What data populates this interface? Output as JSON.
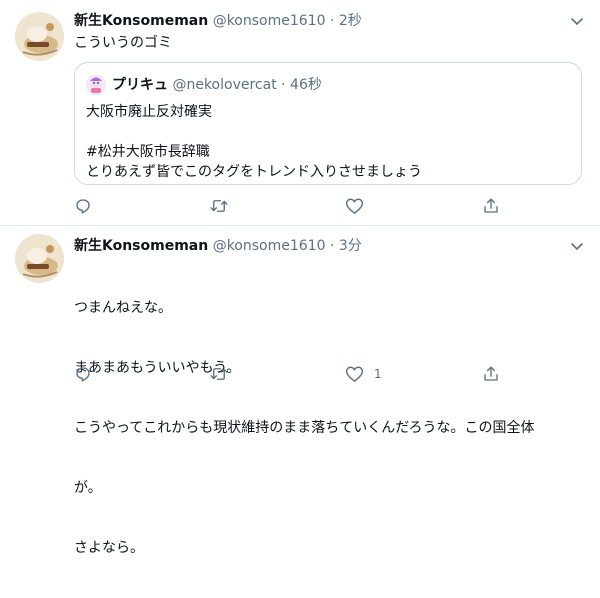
{
  "colors": {
    "muted": "#5b7083",
    "border": "#cfd9de",
    "divider": "#e6ecf0"
  },
  "tweets": [
    {
      "display_name": "新生Konsomeman",
      "handle": "@konsome1610",
      "separator": "·",
      "time": "2秒",
      "text": "こういうのゴミ",
      "quote": {
        "display_name": "プリキュ",
        "handle": "@nekolovercat",
        "separator": "·",
        "time": "46秒",
        "lines": [
          "大阪市廃止反対確実",
          "",
          "#松井大阪市長辞職",
          "とりあえず皆でこのタグをトレンド入りさせましょう"
        ]
      },
      "actions": {
        "reply_icon": "reply-icon",
        "retweet_icon": "retweet-icon",
        "like_icon": "heart-icon",
        "like_count": "",
        "share_icon": "share-icon"
      }
    },
    {
      "display_name": "新生Konsomeman",
      "handle": "@konsome1610",
      "separator": "·",
      "time": "3分",
      "lines": [
        "つまんねえな。",
        "まあまあもういいやもう。",
        "こうやってこれからも現状維持のまま落ちていくんだろうな。この国全体",
        "が。",
        "さよなら。"
      ],
      "actions": {
        "reply_icon": "reply-icon",
        "retweet_icon": "retweet-icon",
        "like_icon": "heart-icon",
        "like_count": "1",
        "share_icon": "share-icon"
      }
    }
  ]
}
